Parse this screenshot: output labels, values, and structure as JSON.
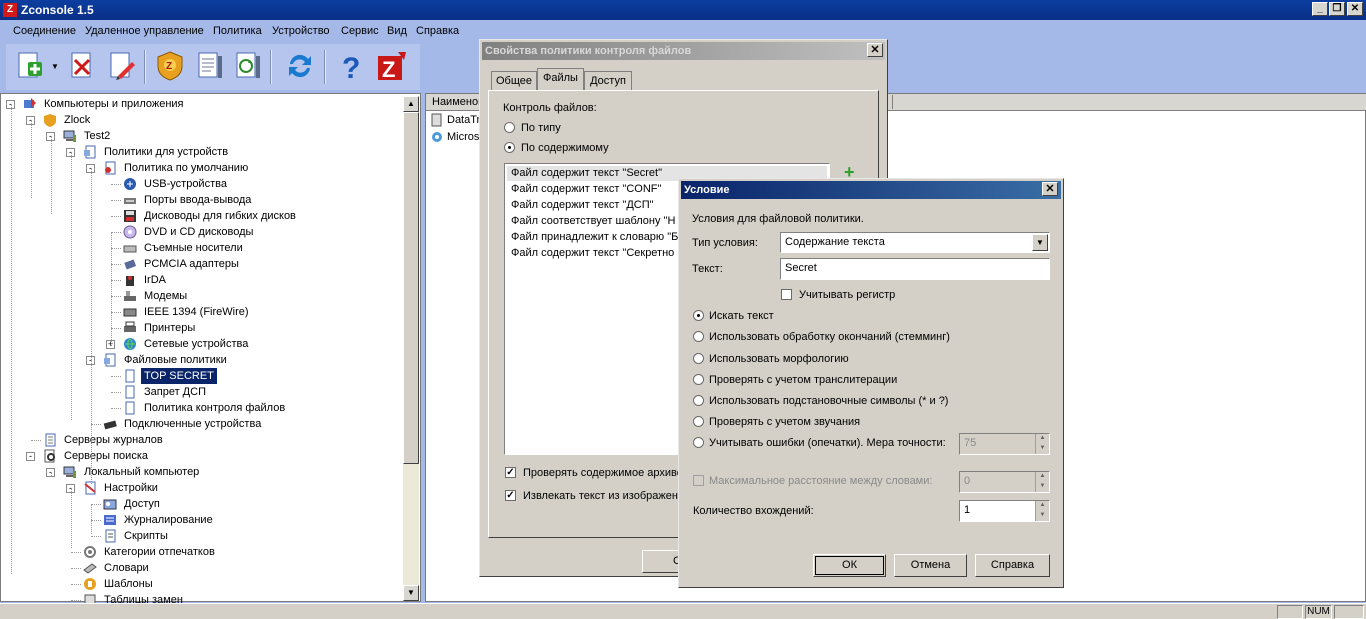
{
  "app": {
    "title": "Zconsole 1.5",
    "icon_letter": "Z",
    "minimize": "_",
    "restore": "❐",
    "close": "✕"
  },
  "menu": [
    "Соединение",
    "Удаленное управление",
    "Политика",
    "Устройство",
    "Сервис",
    "Вид",
    "Справка"
  ],
  "toolbar": [
    {
      "icon": "add-icon",
      "dropdown": true
    },
    {
      "icon": "delete-icon"
    },
    {
      "icon": "edit-icon"
    },
    {
      "icon": "zlock-shield-icon"
    },
    {
      "icon": "policy-settings-icon"
    },
    {
      "icon": "sync-policy-icon"
    },
    {
      "icon": "refresh-icon"
    },
    {
      "icon": "help-icon"
    },
    {
      "icon": "zecurion-icon"
    }
  ],
  "tree": [
    {
      "label": "Компьютеры и приложения",
      "level": 0,
      "expander": "-",
      "icon": "computers-apps-icon"
    },
    {
      "label": "Zlock",
      "level": 1,
      "expander": "-",
      "icon": "zlock-icon"
    },
    {
      "label": "Test2",
      "level": 2,
      "expander": "-",
      "icon": "computer-icon"
    },
    {
      "label": "Политики для устройств",
      "level": 3,
      "expander": "-",
      "icon": "device-policies-icon"
    },
    {
      "label": "Политика по умолчанию",
      "level": 4,
      "expander": "-",
      "icon": "default-policy-icon"
    },
    {
      "label": "USB-устройства",
      "level": 5,
      "icon": "usb-icon"
    },
    {
      "label": "Порты ввода-вывода",
      "level": 5,
      "icon": "io-ports-icon"
    },
    {
      "label": "Дисководы для гибких дисков",
      "level": 5,
      "icon": "floppy-icon"
    },
    {
      "label": "DVD и CD дисководы",
      "level": 5,
      "icon": "dvd-icon"
    },
    {
      "label": "Съемные носители",
      "level": 5,
      "icon": "removable-media-icon"
    },
    {
      "label": "PCMCIA адаптеры",
      "level": 5,
      "icon": "pcmcia-icon"
    },
    {
      "label": "IrDA",
      "level": 5,
      "icon": "irda-icon"
    },
    {
      "label": "Модемы",
      "level": 5,
      "icon": "modem-icon"
    },
    {
      "label": "IEEE 1394 (FireWire)",
      "level": 5,
      "icon": "firewire-icon"
    },
    {
      "label": "Принтеры",
      "level": 5,
      "icon": "printer-icon"
    },
    {
      "label": "Сетевые устройства",
      "level": 5,
      "expander": "+",
      "icon": "network-devices-icon"
    },
    {
      "label": "Файловые политики",
      "level": 4,
      "expander": "-",
      "icon": "file-policies-icon"
    },
    {
      "label": "TOP SECRET",
      "level": 5,
      "icon": "file-policy-icon",
      "selected": true
    },
    {
      "label": "Запрет ДСП",
      "level": 5,
      "icon": "file-policy-icon"
    },
    {
      "label": "Политика контроля файлов",
      "level": 5,
      "icon": "file-policy-icon"
    },
    {
      "label": "Подключенные устройства",
      "level": 4,
      "icon": "connected-devices-icon"
    },
    {
      "label": "Серверы журналов",
      "level": 1,
      "icon": "log-servers-icon"
    },
    {
      "label": "Серверы поиска",
      "level": 1,
      "expander": "-",
      "icon": "search-servers-icon"
    },
    {
      "label": "Локальный компьютер",
      "level": 2,
      "expander": "-",
      "icon": "computer-icon"
    },
    {
      "label": "Настройки",
      "level": 3,
      "expander": "-",
      "icon": "settings-icon"
    },
    {
      "label": "Доступ",
      "level": 4,
      "icon": "access-icon"
    },
    {
      "label": "Журналирование",
      "level": 4,
      "icon": "logging-icon"
    },
    {
      "label": "Скрипты",
      "level": 4,
      "icon": "scripts-icon"
    },
    {
      "label": "Категории отпечатков",
      "level": 3,
      "icon": "fingerprint-categories-icon"
    },
    {
      "label": "Словари",
      "level": 3,
      "icon": "dictionaries-icon"
    },
    {
      "label": "Шаблоны",
      "level": 3,
      "icon": "templates-icon"
    },
    {
      "label": "Таблицы замен",
      "level": 3,
      "icon": "replacement-tables-icon"
    }
  ],
  "right_pane": {
    "header": "Наименов",
    "items": [
      "DataTr",
      "Microsc"
    ]
  },
  "statusbar": {
    "num": "NUM"
  },
  "policy_dialog": {
    "title": "Свойства политики контроля файлов",
    "tabs": [
      "Общее",
      "Файлы",
      "Доступ"
    ],
    "active_tab": "Файлы",
    "control_label": "Контроль файлов:",
    "radio_by_type": "По типу",
    "radio_by_content": "По содержимому",
    "conditions": [
      "Файл содержит текст \"Secret\"",
      "Файл содержит текст \"CONF\"",
      "Файл содержит текст \"ДСП\"",
      "Файл соответствует шаблону \"Н",
      "Файл принадлежит к словарю \"Б",
      "Файл содержит текст \"Секретно"
    ],
    "check_archives": "Проверять содержимое архиво",
    "check_images": "Извлекать текст из изображен",
    "add": "+",
    "ok_partial": "С"
  },
  "condition_dialog": {
    "title": "Условие",
    "subtitle": "Условия для файловой политики.",
    "type_label": "Тип условия:",
    "type_value": "Содержание текста",
    "text_label": "Текст:",
    "text_value": "Secret",
    "case_label": "Учитывать регистр",
    "options": [
      {
        "label": "Искать текст",
        "checked": true
      },
      {
        "label": "Использовать обработку окончаний (стемминг)",
        "checked": false
      },
      {
        "label": "Использовать морфологию",
        "checked": false
      },
      {
        "label": "Проверять с учетом транслитерации",
        "checked": false
      },
      {
        "label": "Использовать подстановочные символы (* и ?)",
        "checked": false
      },
      {
        "label": "Проверять с учетом звучания",
        "checked": false
      },
      {
        "label": "Учитывать ошибки (опечатки). Мера точности:",
        "checked": false
      }
    ],
    "accuracy_value": "75",
    "max_distance_label": "Максимальное расстояние между словами:",
    "max_distance_value": "0",
    "occurrences_label": "Количество вхождений:",
    "occurrences_value": "1",
    "ok": "ОК",
    "cancel": "Отмена",
    "help": "Справка",
    "close": "✕"
  }
}
